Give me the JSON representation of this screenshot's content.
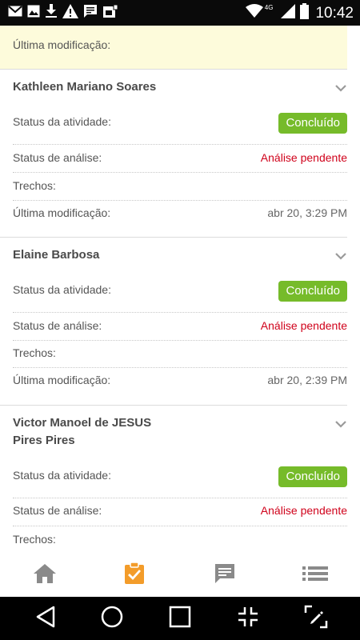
{
  "status_bar": {
    "time": "10:42",
    "network": "4G",
    "icons": [
      "gmail-icon",
      "image-icon",
      "download-icon",
      "warning-icon",
      "message-icon",
      "sim-icon",
      "wifi-icon",
      "signal-icon",
      "battery-icon"
    ]
  },
  "top_partial": {
    "last_modified_label": "Última modificação:"
  },
  "cards": [
    {
      "name": "Kathleen Mariano Soares",
      "activity_status_label": "Status da atividade:",
      "activity_status_value": "Concluído",
      "analysis_status_label": "Status de análise:",
      "analysis_status_value": "Análise pendente",
      "excerpts_label": "Trechos:",
      "last_modified_label": "Última modificação:",
      "last_modified_value": "abr 20, 3:29 PM"
    },
    {
      "name": "Elaine Barbosa",
      "activity_status_label": "Status da atividade:",
      "activity_status_value": "Concluído",
      "analysis_status_label": "Status de análise:",
      "analysis_status_value": "Análise pendente",
      "excerpts_label": "Trechos:",
      "last_modified_label": "Última modificação:",
      "last_modified_value": "abr 20, 2:39 PM"
    },
    {
      "name_line1": "Victor Manoel de JESUS",
      "name_line2": "Pires Pires",
      "activity_status_label": "Status da atividade:",
      "activity_status_value": "Concluído",
      "analysis_status_label": "Status de análise:",
      "analysis_status_value": "Análise pendente",
      "excerpts_label": "Trechos:"
    }
  ],
  "bottom_nav": {
    "items": [
      "home-icon",
      "tasks-icon",
      "messages-icon",
      "list-icon"
    ],
    "active_index": 1
  },
  "colors": {
    "accent_orange": "#f39c2a",
    "badge_green": "#76bb2a",
    "pending_red": "#d0021b",
    "highlight_yellow": "#fdfbdb"
  }
}
